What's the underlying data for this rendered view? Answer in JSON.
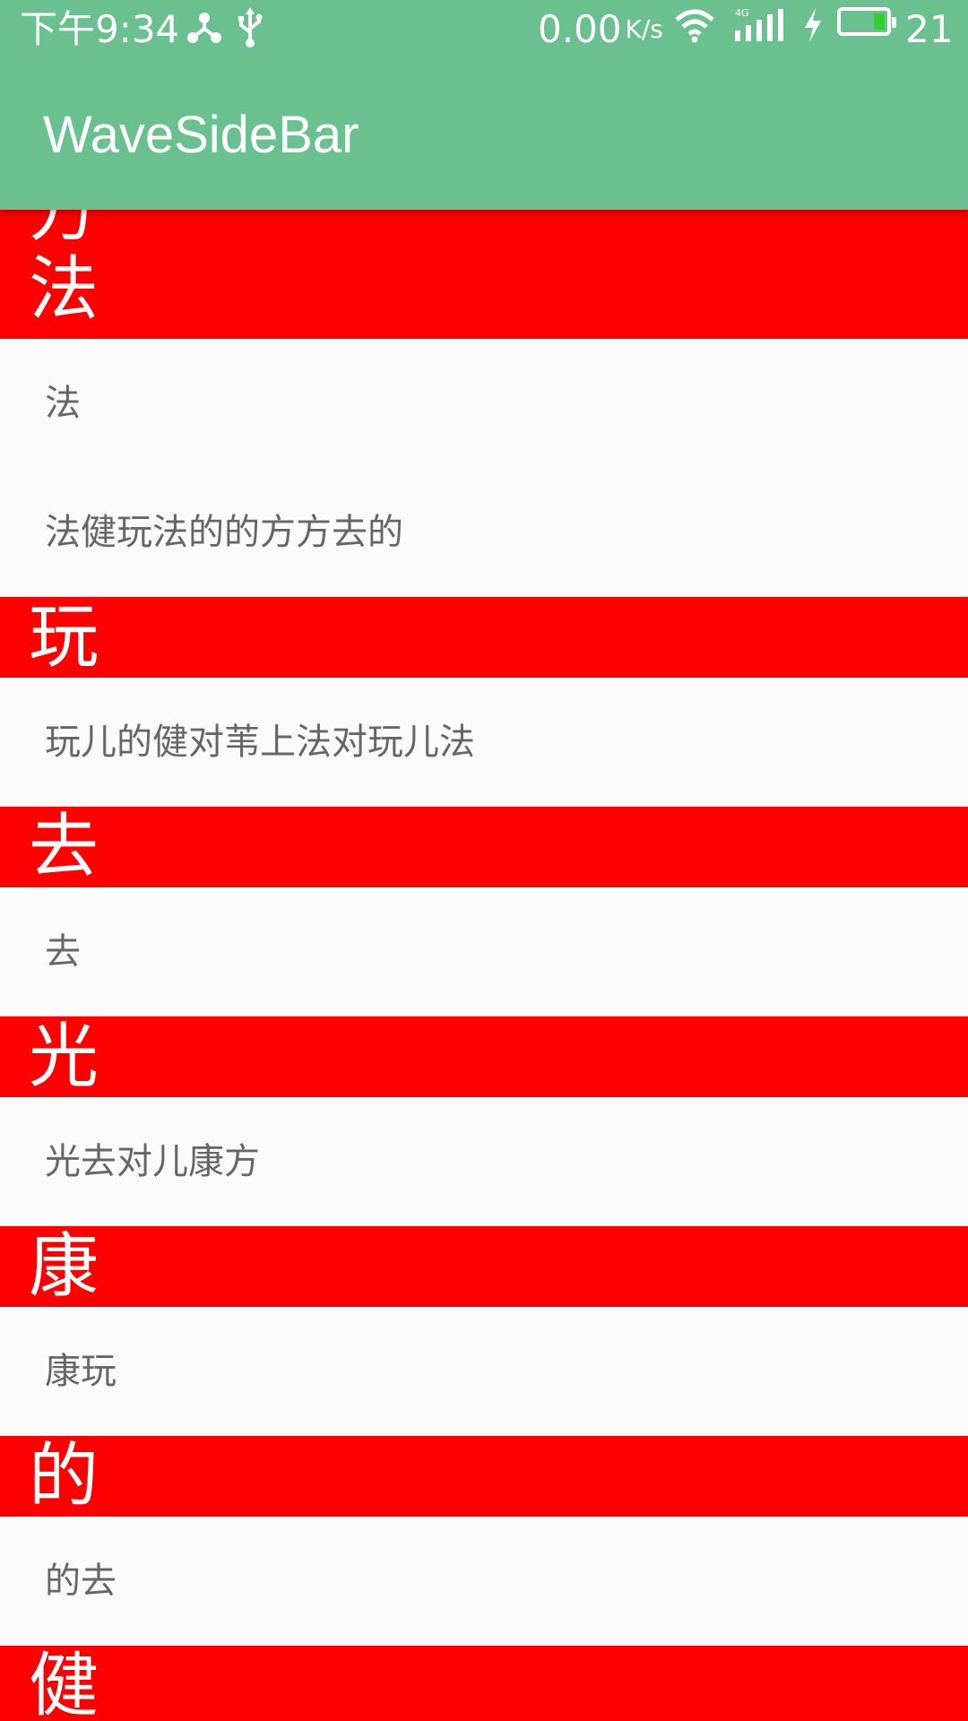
{
  "status_bar": {
    "time": "下午9:34",
    "share_icon": "share-icon",
    "usb_icon": "usb-icon",
    "speed": "0.00",
    "speed_unit": "K/s",
    "wifi_icon": "wifi-icon",
    "signal_icon": "signal-4g-icon",
    "network_type": "4G",
    "charging_icon": "charging-icon",
    "battery_level": "21"
  },
  "toolbar": {
    "title": "WaveSideBar"
  },
  "list": {
    "partial_header_top": "方",
    "sections": [
      {
        "header": "法",
        "items": [
          "法",
          "法健玩法的的方方去的"
        ]
      },
      {
        "header": "玩",
        "items": [
          "玩儿的健对苇上法对玩儿法"
        ]
      },
      {
        "header": "去",
        "items": [
          "去"
        ]
      },
      {
        "header": "光",
        "items": [
          "光去对儿康方"
        ]
      },
      {
        "header": "康",
        "items": [
          "康玩"
        ]
      },
      {
        "header": "的",
        "items": [
          "的去"
        ]
      },
      {
        "header": "健",
        "items": []
      }
    ]
  },
  "colors": {
    "primary": "#6bc08f",
    "section_header": "#ff0000",
    "item_text": "#666666",
    "background": "#fafafa"
  }
}
